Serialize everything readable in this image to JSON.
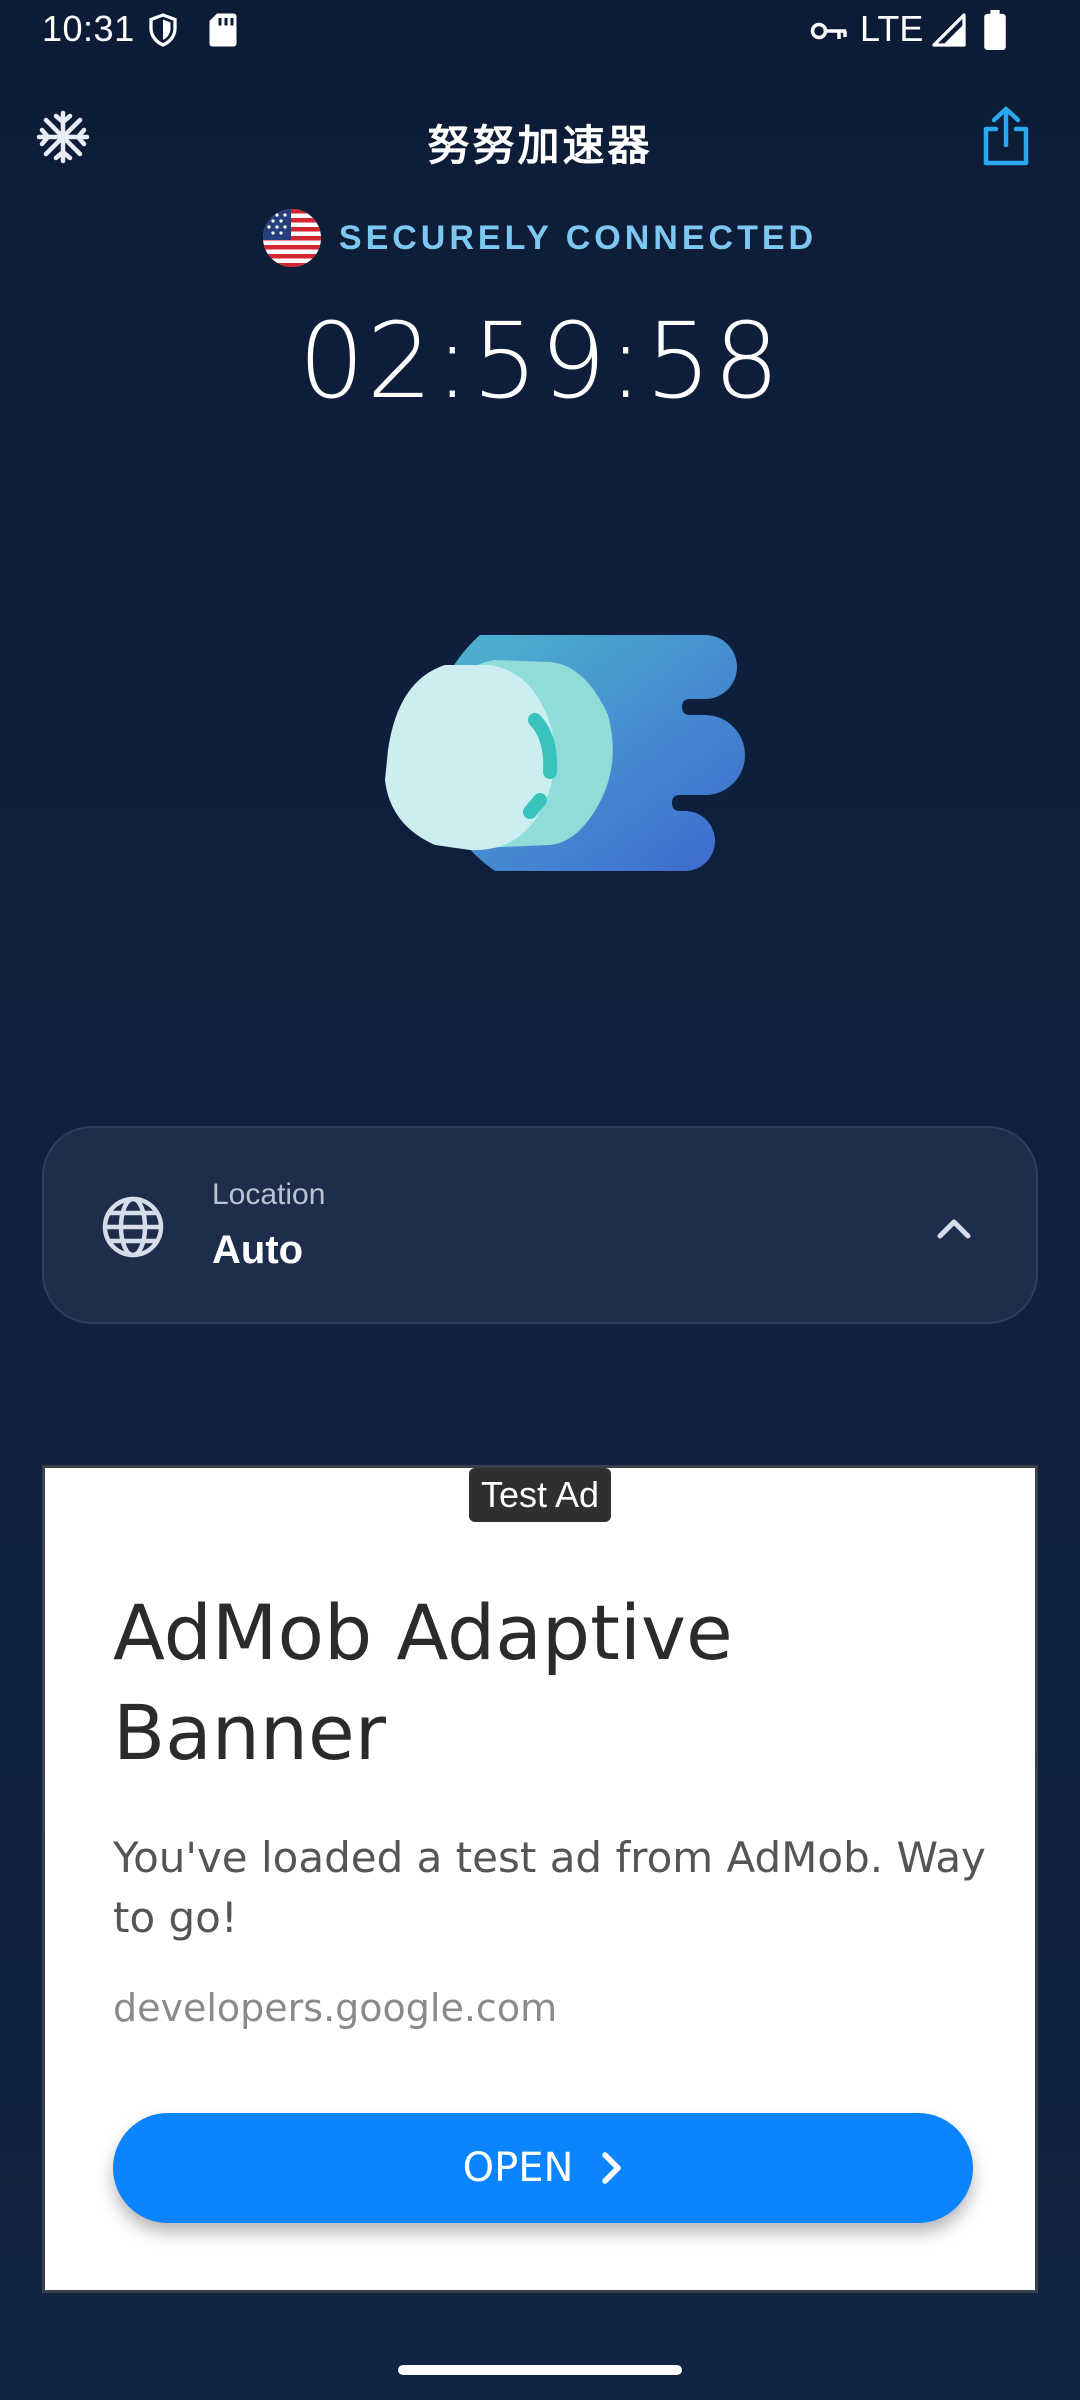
{
  "status_bar": {
    "time": "10:31",
    "network": "LTE",
    "icons": [
      "shield-icon",
      "sd-card-icon",
      "vpn-key-icon",
      "signal-icon",
      "battery-icon"
    ]
  },
  "header": {
    "title": "努努加速器",
    "settings_icon": "snowflake-icon",
    "share_icon": "share-icon"
  },
  "connection": {
    "country_flag": "us-flag",
    "status": "SECURELY CONNECTED",
    "timer": "02:59:58"
  },
  "location": {
    "label": "Location",
    "value": "Auto",
    "icon": "globe-icon",
    "toggle_icon": "chevron-up-icon"
  },
  "ad": {
    "badge": "Test Ad",
    "headline": "AdMob Adaptive Banner",
    "body": "You've loaded a test ad from AdMob. Way to go!",
    "url": "developers.google.com",
    "cta": "OPEN"
  },
  "colors": {
    "background": "#0f2040",
    "accent": "#7cc8f2",
    "card": "#1d2d4b",
    "cta": "#0a84ff",
    "share_icon": "#2aa8f0"
  }
}
